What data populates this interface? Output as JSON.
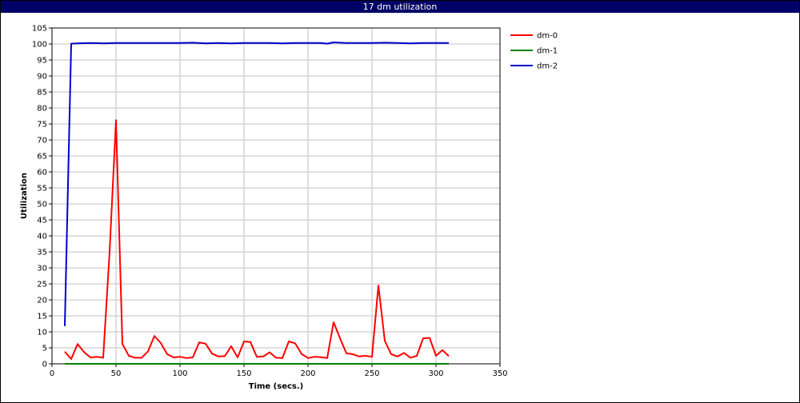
{
  "window": {
    "title": "17 dm utilization"
  },
  "chart_data": {
    "type": "line",
    "title": "17 dm utilization",
    "xlabel": "Time (secs.)",
    "ylabel": "Utilization",
    "xlim": [
      0,
      350
    ],
    "ylim": [
      0,
      105
    ],
    "xticks": [
      0,
      50,
      100,
      150,
      200,
      250,
      300,
      350
    ],
    "yticks": [
      0,
      5,
      10,
      15,
      20,
      25,
      30,
      35,
      40,
      45,
      50,
      55,
      60,
      65,
      70,
      75,
      80,
      85,
      90,
      95,
      100,
      105
    ],
    "grid": true,
    "legend_position": "right",
    "series": [
      {
        "name": "dm-0",
        "color": "#ff0000",
        "x": [
          10,
          15,
          20,
          25,
          30,
          35,
          40,
          45,
          50,
          55,
          60,
          65,
          70,
          75,
          80,
          85,
          90,
          95,
          100,
          105,
          110,
          115,
          120,
          125,
          130,
          135,
          140,
          145,
          150,
          155,
          160,
          165,
          170,
          175,
          180,
          185,
          190,
          195,
          200,
          205,
          210,
          215,
          220,
          225,
          230,
          235,
          240,
          245,
          250,
          255,
          260,
          265,
          270,
          275,
          280,
          285,
          290,
          295,
          300,
          305,
          310
        ],
        "y": [
          3.8,
          1.5,
          6.2,
          3.7,
          2.0,
          2.2,
          1.9,
          35.0,
          76.2,
          6.2,
          2.5,
          1.9,
          1.9,
          3.9,
          8.7,
          6.5,
          3.0,
          2.0,
          2.2,
          1.8,
          2.0,
          6.7,
          6.3,
          3.2,
          2.3,
          2.4,
          5.5,
          2.0,
          7.0,
          6.8,
          2.2,
          2.3,
          3.6,
          1.9,
          1.8,
          7.0,
          6.4,
          3.1,
          1.8,
          2.2,
          2.1,
          1.8,
          13.0,
          8.0,
          3.3,
          3.0,
          2.3,
          2.5,
          2.2,
          24.5,
          7.2,
          3.0,
          2.3,
          3.4,
          1.9,
          2.5,
          8.0,
          8.1,
          2.5,
          4.3,
          2.4
        ]
      },
      {
        "name": "dm-1",
        "color": "#008000",
        "x": [
          10,
          15,
          20,
          40,
          60,
          80,
          100,
          120,
          140,
          160,
          180,
          200,
          220,
          240,
          260,
          280,
          300,
          310
        ],
        "y": [
          0,
          0,
          0,
          0,
          0,
          0,
          0,
          0,
          0,
          0,
          0,
          0,
          0,
          0,
          0,
          0,
          0,
          0
        ]
      },
      {
        "name": "dm-2",
        "color": "#0000cc",
        "x": [
          10,
          15,
          20,
          30,
          40,
          50,
          60,
          70,
          80,
          90,
          100,
          110,
          120,
          130,
          140,
          150,
          160,
          170,
          180,
          190,
          200,
          210,
          215,
          220,
          230,
          240,
          250,
          260,
          270,
          280,
          290,
          300,
          310
        ],
        "y": [
          11.8,
          100.1,
          100.2,
          100.3,
          100.2,
          100.3,
          100.3,
          100.3,
          100.3,
          100.3,
          100.3,
          100.4,
          100.2,
          100.3,
          100.2,
          100.3,
          100.3,
          100.3,
          100.2,
          100.3,
          100.3,
          100.3,
          100.1,
          100.5,
          100.3,
          100.3,
          100.3,
          100.4,
          100.3,
          100.2,
          100.3,
          100.3,
          100.3
        ]
      }
    ]
  }
}
